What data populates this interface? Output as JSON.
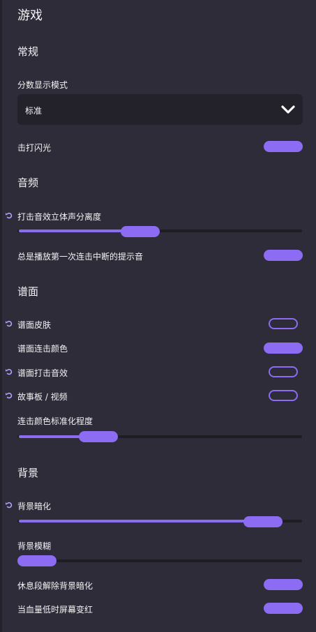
{
  "title": "游戏",
  "sections": {
    "general": "常规",
    "audio": "音频",
    "beatmap": "谱面",
    "background": "背景"
  },
  "general": {
    "score_display_label": "分数显示模式",
    "score_display_value": "标准",
    "hit_lighting_label": "击打闪光",
    "hit_lighting_on": true
  },
  "audio": {
    "stereo_label": "打击音效立体声分离度",
    "stereo_value": 0.42,
    "combo_break_label": "总是播放第一次连击中断的提示音",
    "combo_break_on": true
  },
  "beatmap": {
    "skins_label": "谱面皮肤",
    "skins_on": false,
    "colours_label": "谱面连击颜色",
    "colours_on": true,
    "hitsounds_label": "谱面打击音效",
    "hitsounds_on": false,
    "storyboard_label": "故事板 / 视频",
    "storyboard_on": false,
    "normalisation_label": "连击颜色标准化程度",
    "normalisation_value": 0.25
  },
  "background": {
    "dim_label": "背景暗化",
    "dim_value": 0.92,
    "blur_label": "背景模糊",
    "blur_value": 0.0,
    "break_dim_label": "休息段解除背景暗化",
    "break_dim_on": true,
    "low_health_label": "当血量低时屏幕变红",
    "low_health_on": true
  },
  "colors": {
    "accent": "#8b6cf2",
    "panel": "#2e2c38",
    "track": "#1e1d24"
  },
  "icons": {
    "revert": "revert-icon",
    "chevron": "chevron-down-icon"
  }
}
